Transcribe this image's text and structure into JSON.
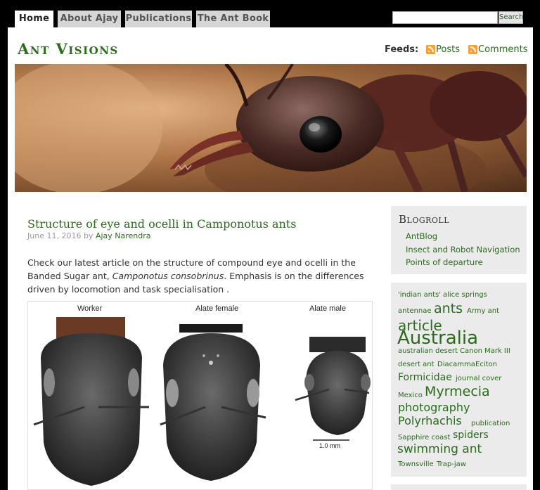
{
  "nav": {
    "tabs": [
      {
        "label": "Home"
      },
      {
        "label": "About Ajay"
      },
      {
        "label": "Publications"
      },
      {
        "label": "The Ant Book"
      }
    ],
    "search_button": "Search"
  },
  "header": {
    "site_title": "Ant Visions",
    "feeds_label": "Feeds:",
    "feed_posts": "Posts",
    "feed_comments": "Comments"
  },
  "post": {
    "title": "Structure of eye and ocelli in Camponotus ants",
    "date": "June 11, 2016",
    "by": "by",
    "author": "Ajay Narendra",
    "body_part1": "Check our latest article on the structure of compound eye and ocelli in the Banded Sugar ant,",
    "body_italic": "Camponotus consobrinus",
    "body_part2": ". Emphasis is on the differences driven by locomotion and task specialisation .",
    "figure": {
      "labels": [
        "Worker",
        "Alate female",
        "Alate male"
      ],
      "scale": "1.0 mm"
    }
  },
  "sidebar": {
    "blogroll_title": "Blogroll",
    "blogroll_links": [
      "AntBlog",
      "Insect and Robot Navigation",
      "Points of departure"
    ],
    "tags": [
      "'indian ants'",
      "alice springs",
      "antennae",
      "ants",
      "Army ant",
      "article",
      "Australia",
      "australian desert",
      "Canon Mark III",
      "desert ant",
      "Diacamma",
      "Eciton",
      "Formicidae",
      "journal cover",
      "Mexico",
      "Myrmecia",
      "photography",
      "Polyrhachis",
      "publication",
      "Sapphire coast",
      "spiders",
      "swimming ant",
      "Townsville",
      "Trap-jaw"
    ]
  },
  "colors": {
    "accent": "#2c6a1e",
    "rss": "#f7a13a",
    "sidebar_bg": "#ebebeb"
  }
}
